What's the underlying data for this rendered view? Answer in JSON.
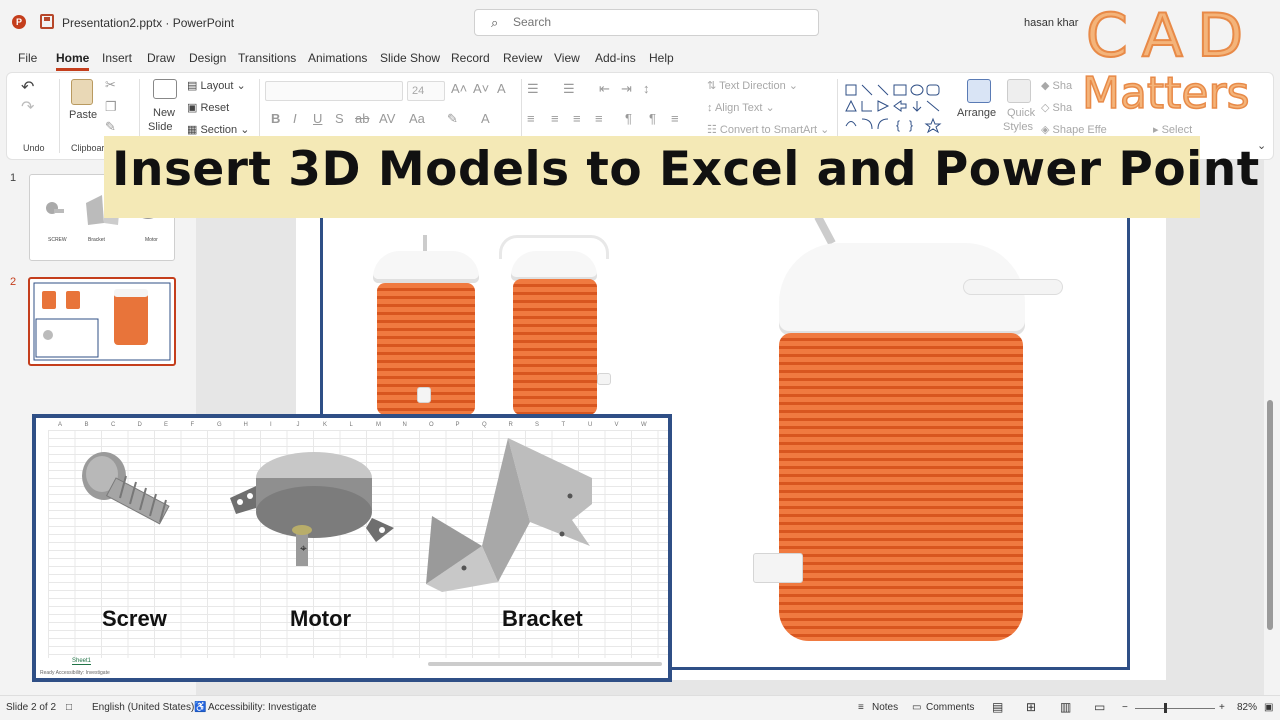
{
  "titlebar": {
    "app_icon": "powerpoint-icon",
    "doc_title": "Presentation2.pptx  ·  PowerPoint",
    "search_placeholder": "Search",
    "user": "hasan khar"
  },
  "tabs": [
    "File",
    "Home",
    "Insert",
    "Draw",
    "Design",
    "Transitions",
    "Animations",
    "Slide Show",
    "Record",
    "Review",
    "View",
    "Add-ins",
    "Help"
  ],
  "active_tab": "Home",
  "ribbon": {
    "undo_group": "Undo",
    "paste": "Paste",
    "clipboard_group": "Clipboar",
    "new_slide_1": "New",
    "new_slide_2": "Slide",
    "layout": "Layout",
    "reset": "Reset",
    "section": "Section",
    "font_size": "24",
    "text_direction": "Text Direction",
    "align_text": "Align Text",
    "convert_smartart": "Convert to SmartArt",
    "arrange": "Arrange",
    "quick_styles_1": "Quick",
    "quick_styles_2": "Styles",
    "shape_fill": "Sha",
    "shape_outline": "Sha",
    "shape_effects": "Shape Effe",
    "select": "Select"
  },
  "thumbnails": {
    "slide1_num": "1",
    "slide2_num": "2",
    "slide1_labels": [
      "SCREW",
      "Bracket",
      "Motor"
    ]
  },
  "banner": {
    "title": "Insert 3D Models to Excel and Power Point"
  },
  "logo": {
    "top": "CAD",
    "bottom": "Matters"
  },
  "excel_inset": {
    "columns": [
      "A",
      "B",
      "C",
      "D",
      "E",
      "F",
      "G",
      "H",
      "I",
      "J",
      "K",
      "L",
      "M",
      "N",
      "O",
      "P",
      "Q",
      "R",
      "S",
      "T",
      "U",
      "V",
      "W"
    ],
    "labels": [
      "Screw",
      "Motor",
      "Bracket"
    ],
    "sheet_tab": "Sheet1",
    "status": "Ready    Accessibility: Investigate"
  },
  "statusbar": {
    "slide_info": "Slide 2 of 2",
    "language": "English (United States)",
    "accessibility": "Accessibility: Investigate",
    "notes": "Notes",
    "comments": "Comments",
    "zoom_level": "82%"
  }
}
